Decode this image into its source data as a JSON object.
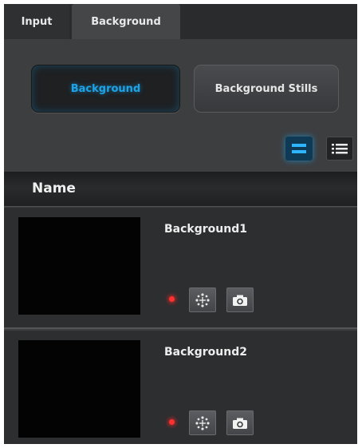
{
  "tabs": [
    {
      "label": "Input",
      "active": false
    },
    {
      "label": "Background",
      "active": true
    }
  ],
  "mode_buttons": [
    {
      "label": "Background",
      "active": true
    },
    {
      "label": "Background Stills",
      "active": false
    }
  ],
  "view_toggle": {
    "active": "grid-view",
    "options": [
      "grid-view-icon",
      "list-view-icon"
    ]
  },
  "table": {
    "column_header": "Name",
    "rows": [
      {
        "name": "Background1",
        "status": "red",
        "actions": [
          "freeze-icon",
          "camera-icon"
        ]
      },
      {
        "name": "Background2",
        "status": "red",
        "actions": [
          "freeze-icon",
          "camera-icon"
        ]
      }
    ]
  },
  "colors": {
    "accent": "#1ea3e6",
    "status_dot": "#ff3030",
    "panel": "#3d3e40"
  }
}
